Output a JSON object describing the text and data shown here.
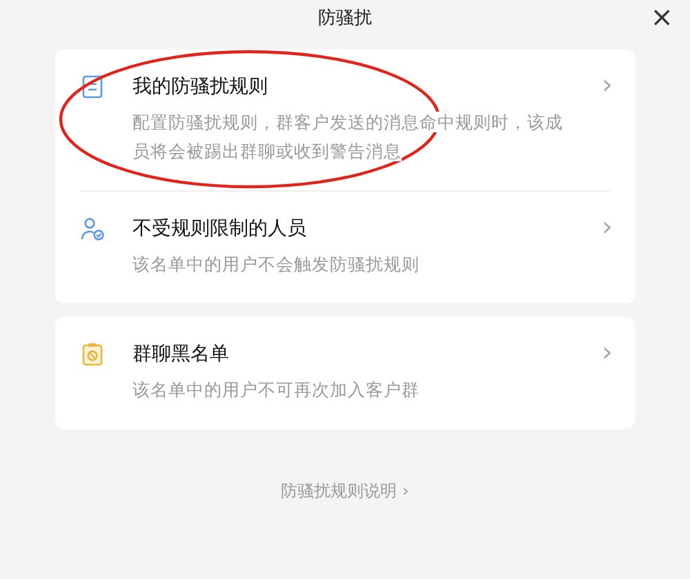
{
  "window": {
    "title": "防骚扰",
    "close": "×"
  },
  "groups": [
    {
      "items": [
        {
          "kind": "rules",
          "title": "我的防骚扰规则",
          "description": "配置防骚扰规则，群客户发送的消息命中规则时，该成员将会被踢出群聊或收到警告消息",
          "arrow": "›",
          "highlighted": true
        },
        {
          "kind": "people",
          "title": "不受规则限制的人员",
          "description": "该名单中的用户不会触发防骚扰规则",
          "arrow": "›",
          "highlighted": false
        }
      ]
    },
    {
      "items": [
        {
          "kind": "blacklist",
          "title": "群聊黑名单",
          "description": "该名单中的用户不可再次加入客户群",
          "arrow": "›",
          "highlighted": false
        }
      ]
    }
  ],
  "footer_link": {
    "label": "防骚扰规则说明",
    "arrow": "›"
  }
}
